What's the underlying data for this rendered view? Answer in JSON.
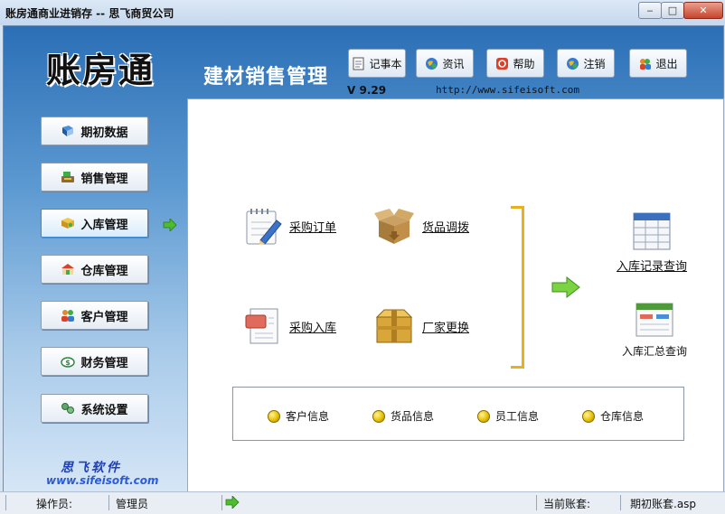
{
  "window": {
    "title": "账房通商业进销存 -- 思飞商贸公司",
    "controls": {
      "minimize": "‒",
      "maximize": "□",
      "close": "✕"
    }
  },
  "header": {
    "logo": "账房通",
    "product": "建材销售管理",
    "version": "V 9.29",
    "url": "http://www.sifeisoft.com"
  },
  "toolbar": [
    {
      "label": "记事本",
      "icon": "notepad-icon"
    },
    {
      "label": "资讯",
      "icon": "news-icon"
    },
    {
      "label": "帮助",
      "icon": "help-icon"
    },
    {
      "label": "注销",
      "icon": "logout-icon"
    },
    {
      "label": "退出",
      "icon": "exit-icon"
    }
  ],
  "sidebar": {
    "items": [
      {
        "label": "期初数据",
        "icon": "book-icon"
      },
      {
        "label": "销售管理",
        "icon": "cash-register-icon"
      },
      {
        "label": "入库管理",
        "icon": "box-icon",
        "active": true
      },
      {
        "label": "仓库管理",
        "icon": "warehouse-icon"
      },
      {
        "label": "客户管理",
        "icon": "people-icon"
      },
      {
        "label": "财务管理",
        "icon": "money-icon"
      },
      {
        "label": "系统设置",
        "icon": "gears-icon"
      }
    ],
    "brand_cn": "思飞软件",
    "brand_url": "www.sifeisoft.com"
  },
  "panel": {
    "features": [
      {
        "label": "采购订单",
        "icon": "notepad-pencil-icon"
      },
      {
        "label": "货品调拨",
        "icon": "open-box-icon"
      },
      {
        "label": "采购入库",
        "icon": "document-icon"
      },
      {
        "label": "厂家更换",
        "icon": "closed-box-icon"
      }
    ],
    "queries": [
      {
        "label": "入库记录查询",
        "icon": "table-icon"
      },
      {
        "label": "入库汇总查询",
        "icon": "report-icon"
      }
    ],
    "basic_info": [
      {
        "label": "客户信息"
      },
      {
        "label": "货品信息"
      },
      {
        "label": "员工信息"
      },
      {
        "label": "仓库信息"
      }
    ]
  },
  "status": {
    "operator_label": "操作员:",
    "operator_value": "管理员",
    "account_label": "当前账套:",
    "account_value": "期初账套.asp"
  }
}
